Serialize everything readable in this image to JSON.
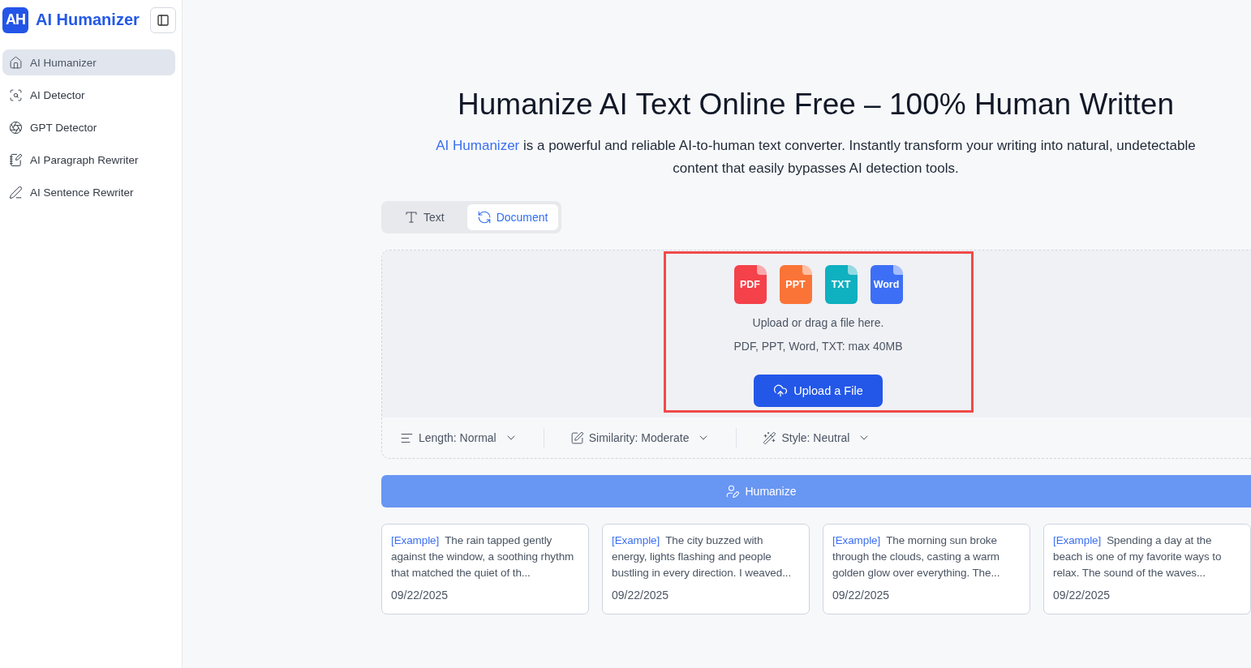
{
  "brand": {
    "logo": "AH",
    "name": "AI Humanizer"
  },
  "sidebar": {
    "items": [
      {
        "label": "AI Humanizer",
        "selected": true
      },
      {
        "label": "AI Detector",
        "selected": false
      },
      {
        "label": "GPT Detector",
        "selected": false
      },
      {
        "label": "AI Paragraph Rewriter",
        "selected": false
      },
      {
        "label": "AI Sentence Rewriter",
        "selected": false
      }
    ]
  },
  "hero": {
    "title": "Humanize AI Text Online Free – 100% Human Written",
    "link": "AI Humanizer",
    "subtitle": " is a powerful and reliable AI-to-human text converter. Instantly transform your writing into natural, undetectable content that easily bypasses AI detection tools."
  },
  "tabs": [
    {
      "label": "Text",
      "kind": "text",
      "selected": false
    },
    {
      "label": "Document",
      "kind": "document",
      "selected": true
    }
  ],
  "upload": {
    "file_types": [
      {
        "label": "PDF",
        "color": "#f5414a"
      },
      {
        "label": "PPT",
        "color": "#fb7437"
      },
      {
        "label": "TXT",
        "color": "#0fb0bf"
      },
      {
        "label": "Word",
        "color": "#3d6ff6"
      }
    ],
    "hint": "Upload or drag a file here.",
    "limits": "PDF, PPT, Word, TXT: max 40MB",
    "button": "Upload a File"
  },
  "options": [
    {
      "kind": "length",
      "label": "Length: Normal"
    },
    {
      "kind": "similarity",
      "label": "Similarity: Moderate"
    },
    {
      "kind": "style",
      "label": "Style: Neutral"
    }
  ],
  "humanize_button": "Humanize",
  "examples": [
    {
      "tag": "[Example]",
      "text": "The rain tapped gently against the window, a soothing rhythm that matched the quiet of th...",
      "date": "09/22/2025"
    },
    {
      "tag": "[Example]",
      "text": "The city buzzed with energy, lights flashing and people bustling in every direction. I weaved...",
      "date": "09/22/2025"
    },
    {
      "tag": "[Example]",
      "text": "The morning sun broke through the clouds, casting a warm golden glow over everything. The...",
      "date": "09/22/2025"
    },
    {
      "tag": "[Example]",
      "text": "Spending a day at the beach is one of my favorite ways to relax. The sound of the waves...",
      "date": "09/22/2025"
    }
  ]
}
